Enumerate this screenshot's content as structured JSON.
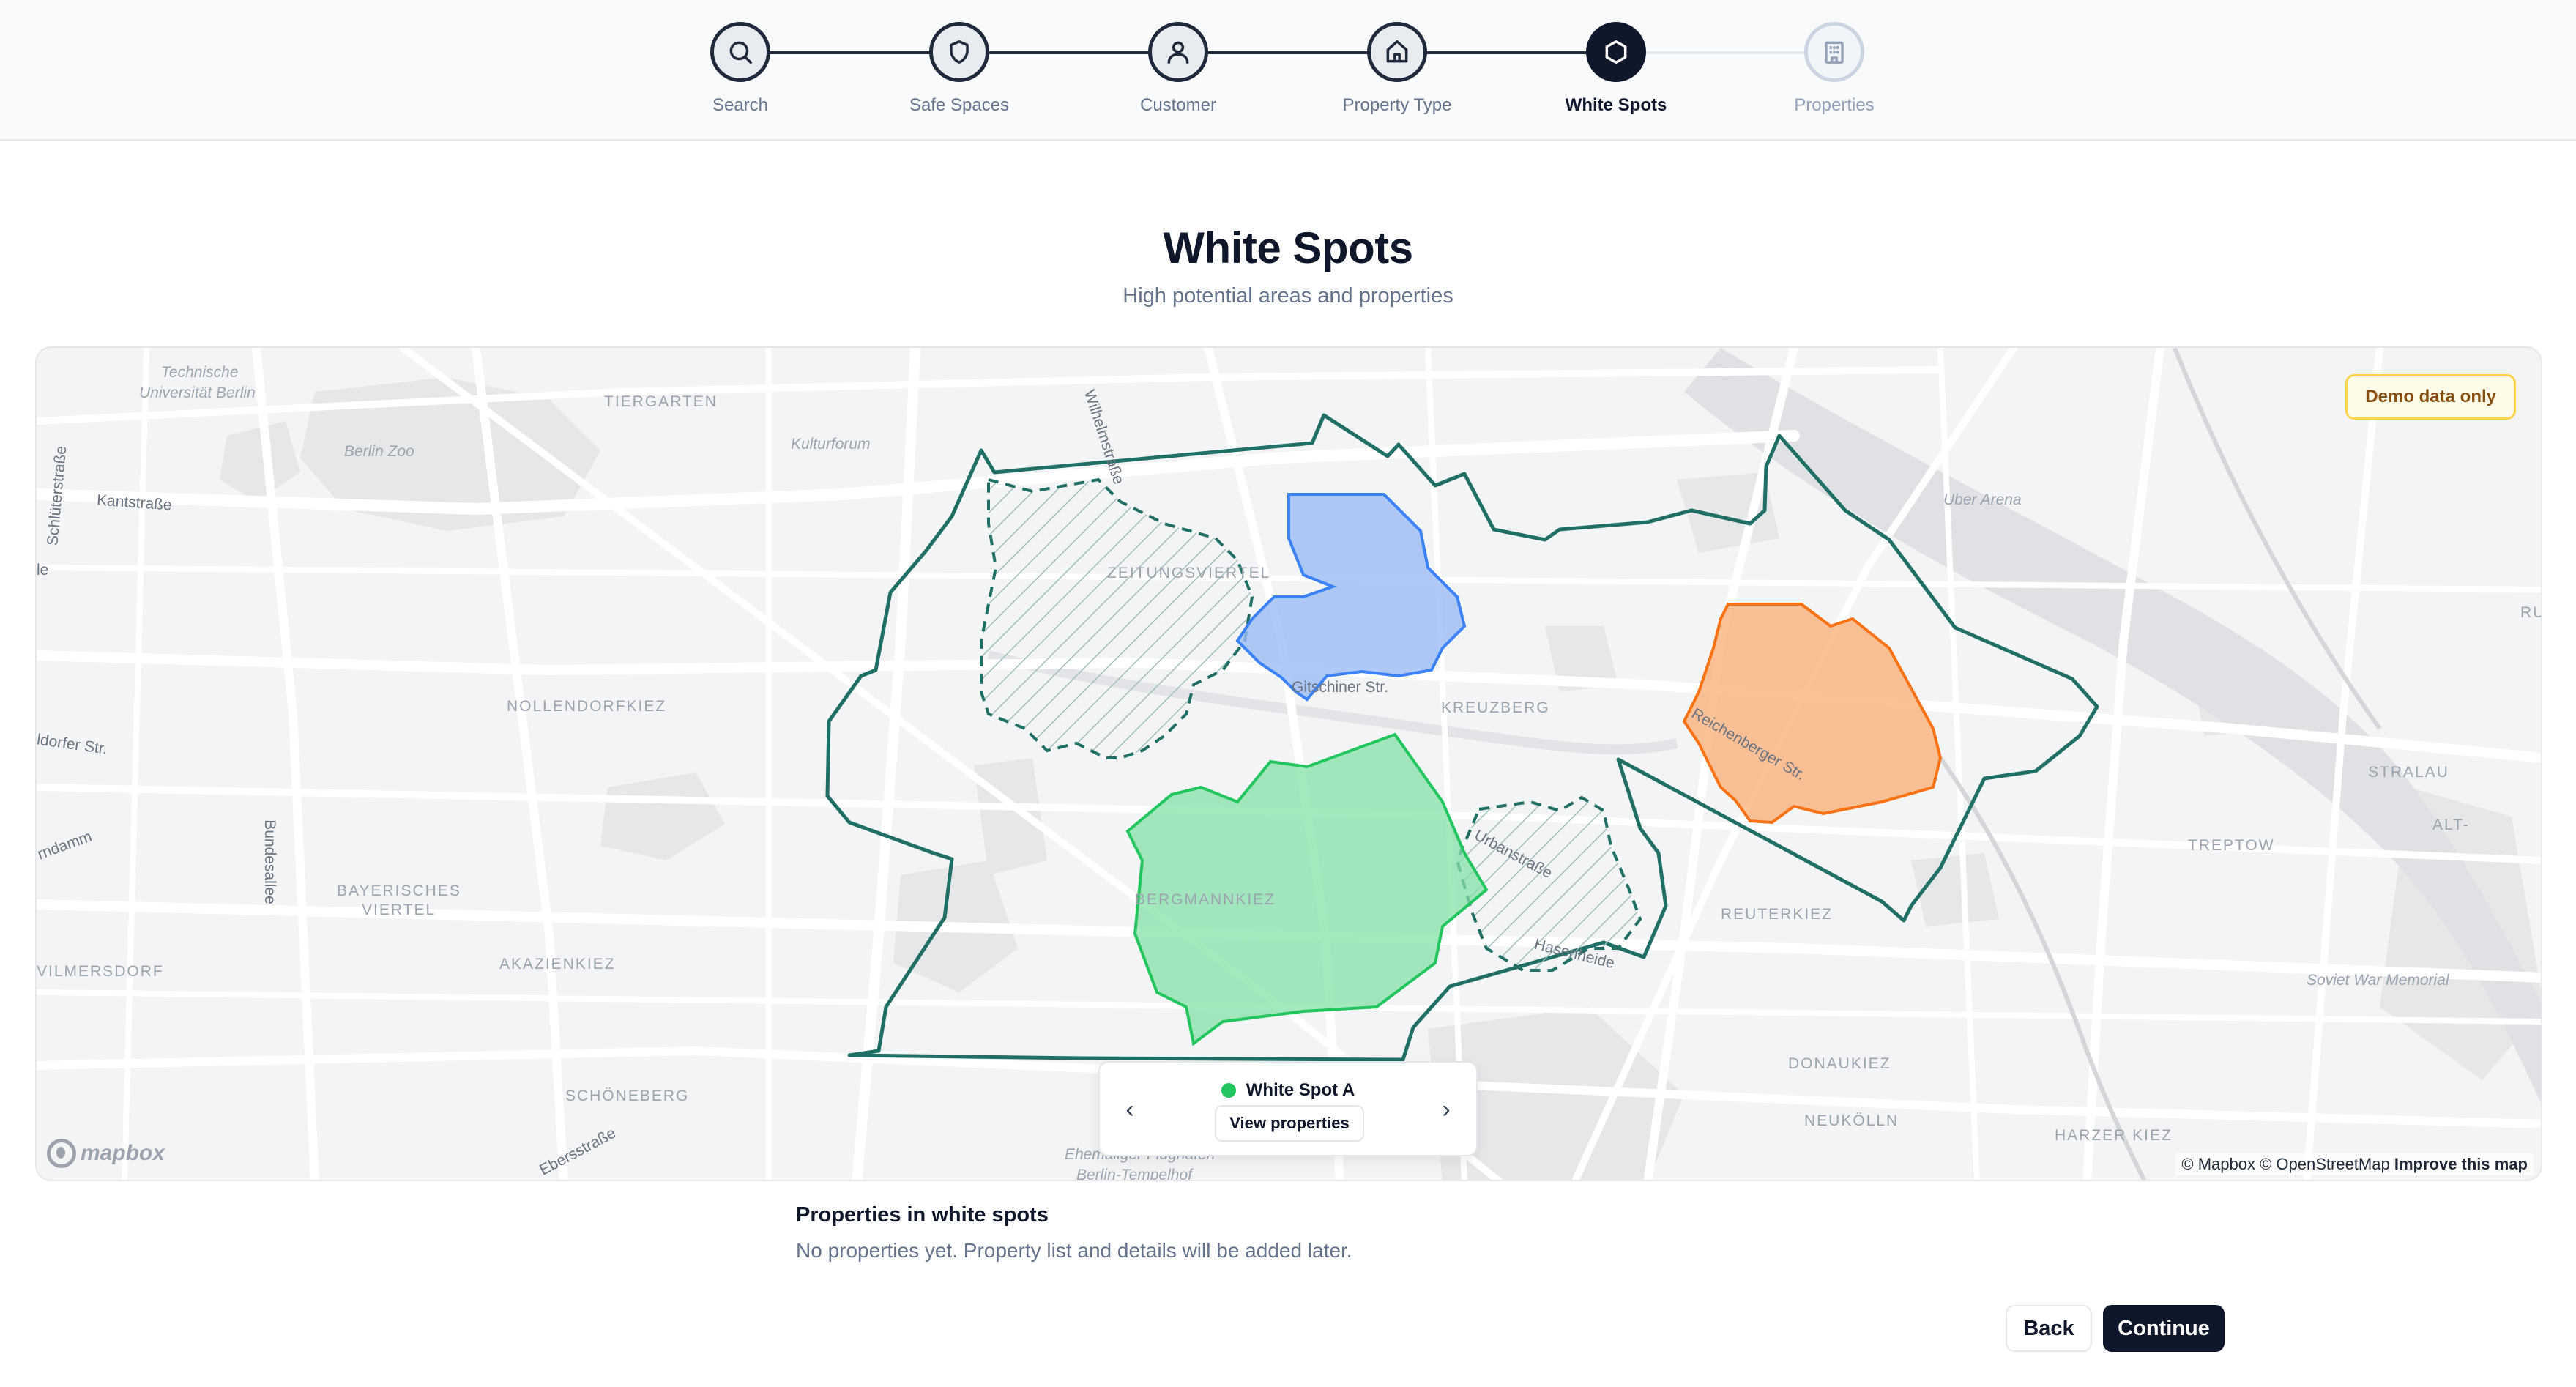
{
  "stepper": {
    "steps": [
      {
        "label": "Search",
        "icon": "search-icon",
        "state": "done"
      },
      {
        "label": "Safe Spaces",
        "icon": "shield-icon",
        "state": "done"
      },
      {
        "label": "Customer",
        "icon": "user-icon",
        "state": "done"
      },
      {
        "label": "Property Type",
        "icon": "home-icon",
        "state": "done"
      },
      {
        "label": "White Spots",
        "icon": "hexagon-icon",
        "state": "active"
      },
      {
        "label": "Properties",
        "icon": "building-icon",
        "state": "future"
      }
    ]
  },
  "header": {
    "title": "White Spots",
    "subtitle": "High potential areas and properties"
  },
  "map": {
    "badge": "Demo data only",
    "labels": {
      "tu": "Technische",
      "tu2": "Universität Berlin",
      "tiergarten": "TIERGARTEN",
      "kulturforum": "Kulturforum",
      "zoo": "Berlin Zoo",
      "kant": "Kantstraße",
      "schlueter": "Schlüterstraße",
      "wilhelm": "Wilhelmstraße",
      "zeitung": "ZEITUNGSVIERTEL",
      "uber": "Uber Arena",
      "ru": "RU",
      "nollendorf": "NOLLENDORFKIEZ",
      "kreuzberg": "KREUZBERG",
      "gitschiner": "Gitschiner Str.",
      "reichenberger": "Reichenberger Str.",
      "dorfer": "ldorfer Str.",
      "stralau": "STRALAU",
      "alt": "ALT-",
      "treptow": "TREPTOW",
      "bundesallee": "Bundesallee",
      "damm": "rndamm",
      "bayerisches": "BAYERISCHES",
      "viertel": "VIERTEL",
      "bergmann": "BERGMANNKIEZ",
      "urban": "Urbanstraße",
      "hasenheide": "Hasenheide",
      "reuter": "REUTERKIEZ",
      "akazien": "AKAZIENKIEZ",
      "wilmersdorf": "VILMERSDORF",
      "soviet": "Soviet War Memorial",
      "schoeneberg": "SCHÖNEBERG",
      "donau": "DONAUKIEZ",
      "neukoelln": "NEUKÖLLN",
      "harzer": "HARZER KIEZ",
      "ebers": "Ebersstraße",
      "tempel1": "Ehemaliger Flughafen",
      "tempel2": "Berlin-Tempelhof",
      "je": "le"
    },
    "mapbox": "mapbox",
    "attribution_prefix": "© Mapbox © OpenStreetMap",
    "attribution_link": "Improve this map",
    "polygons": [
      {
        "name": "district-boundary",
        "color": "#1f6f66"
      },
      {
        "name": "White Spot A",
        "color": "#22c55e"
      },
      {
        "name": "white-spot-blue",
        "color": "#3b82f6"
      },
      {
        "name": "white-spot-orange",
        "color": "#f97316"
      }
    ],
    "card": {
      "title": "White Spot A",
      "view_label": "View properties",
      "prev": "‹",
      "next": "›"
    }
  },
  "properties": {
    "title": "Properties in white spots",
    "empty": "No properties yet. Property list and details will be added later."
  },
  "actions": {
    "back": "Back",
    "continue": "Continue"
  }
}
